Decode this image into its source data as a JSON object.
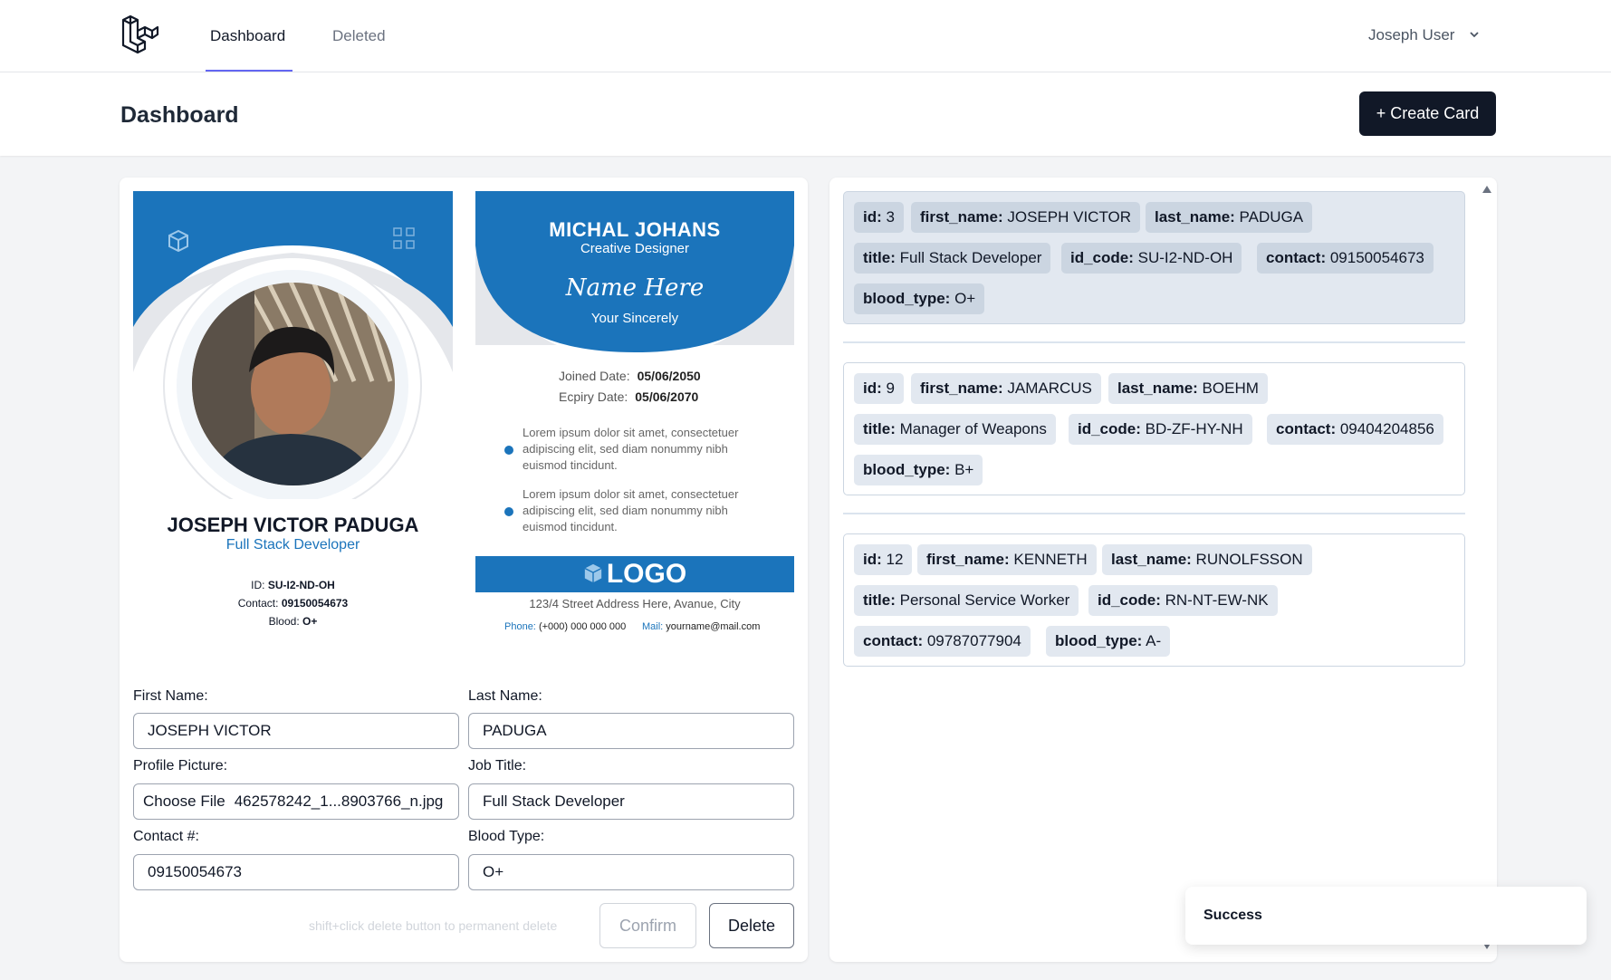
{
  "nav": {
    "tabs": [
      {
        "label": "Dashboard"
      },
      {
        "label": "Deleted"
      }
    ],
    "user": "Joseph User"
  },
  "header": {
    "title": "Dashboard",
    "create_button": "+ Create Card"
  },
  "card_front": {
    "name": "JOSEPH VICTOR PADUGA",
    "role": "Full Stack Developer",
    "id_label": "ID:",
    "id_value": "SU-I2-ND-OH",
    "contact_label": "Contact:",
    "contact_value": "09150054673",
    "blood_label": "Blood:",
    "blood_value": "O+"
  },
  "card_back": {
    "name": "MICHAL JOHANS",
    "role": "Creative Designer",
    "signature": "Name Here",
    "sincerely": "Your Sincerely",
    "joined_label": "Joined Date:",
    "joined_value": "05/06/2050",
    "expiry_label": "Ecpiry Date:",
    "expiry_value": "05/06/2070",
    "bullets": [
      "Lorem ipsum dolor sit amet, consectetuer adipiscing elit, sed diam nonummy nibh euismod tincidunt.",
      "Lorem ipsum dolor sit amet, consectetuer adipiscing elit, sed diam nonummy nibh euismod tincidunt."
    ],
    "logo": "LOGO",
    "address": "123/4 Street Address Here, Avanue, City",
    "phone_label": "Phone:",
    "phone_value": "(+000) 000 000 000",
    "mail_label": "Mail:",
    "mail_value": "yourname@mail.com"
  },
  "form": {
    "first_name_label": "First Name:",
    "first_name": "JOSEPH VICTOR",
    "last_name_label": "Last Name:",
    "last_name": "PADUGA",
    "profile_label": "Profile Picture:",
    "choose_file": "Choose File",
    "file_name": "462578242_1...8903766_n.jpg",
    "job_label": "Job Title:",
    "job_title": "Full Stack Developer",
    "contact_label": "Contact #:",
    "contact": "09150054673",
    "blood_label": "Blood Type:",
    "blood": "O+",
    "hint": "shift+click delete button to permanent delete",
    "confirm": "Confirm",
    "delete": "Delete"
  },
  "records": [
    {
      "chips": [
        {
          "k": "id:",
          "v": " 3"
        },
        {
          "k": "first_name:",
          "v": " JOSEPH VICTOR"
        },
        {
          "k": "last_name:",
          "v": " PADUGA"
        },
        {
          "k": "title:",
          "v": " Full Stack Developer"
        },
        {
          "k": "id_code:",
          "v": " SU-I2-ND-OH"
        },
        {
          "k": "contact:",
          "v": " 09150054673"
        },
        {
          "k": "blood_type:",
          "v": " O+"
        }
      ]
    },
    {
      "chips": [
        {
          "k": "id:",
          "v": " 9"
        },
        {
          "k": "first_name:",
          "v": " JAMARCUS"
        },
        {
          "k": "last_name:",
          "v": " BOEHM"
        },
        {
          "k": "title:",
          "v": " Manager of Weapons"
        },
        {
          "k": "id_code:",
          "v": " BD-ZF-HY-NH"
        },
        {
          "k": "contact:",
          "v": " 09404204856"
        },
        {
          "k": "blood_type:",
          "v": " B+"
        }
      ]
    },
    {
      "chips": [
        {
          "k": "id:",
          "v": " 12"
        },
        {
          "k": "first_name:",
          "v": " KENNETH"
        },
        {
          "k": "last_name:",
          "v": " RUNOLFSSON"
        },
        {
          "k": "title:",
          "v": " Personal Service Worker"
        },
        {
          "k": "id_code:",
          "v": " RN-NT-EW-NK"
        },
        {
          "k": "contact:",
          "v": " 09787077904"
        },
        {
          "k": "blood_type:",
          "v": " A-"
        }
      ]
    }
  ],
  "toast": "Success",
  "colors": {
    "brand_blue": "#1b74bb",
    "nav_accent": "#6366f1",
    "button_dark": "#111827"
  }
}
